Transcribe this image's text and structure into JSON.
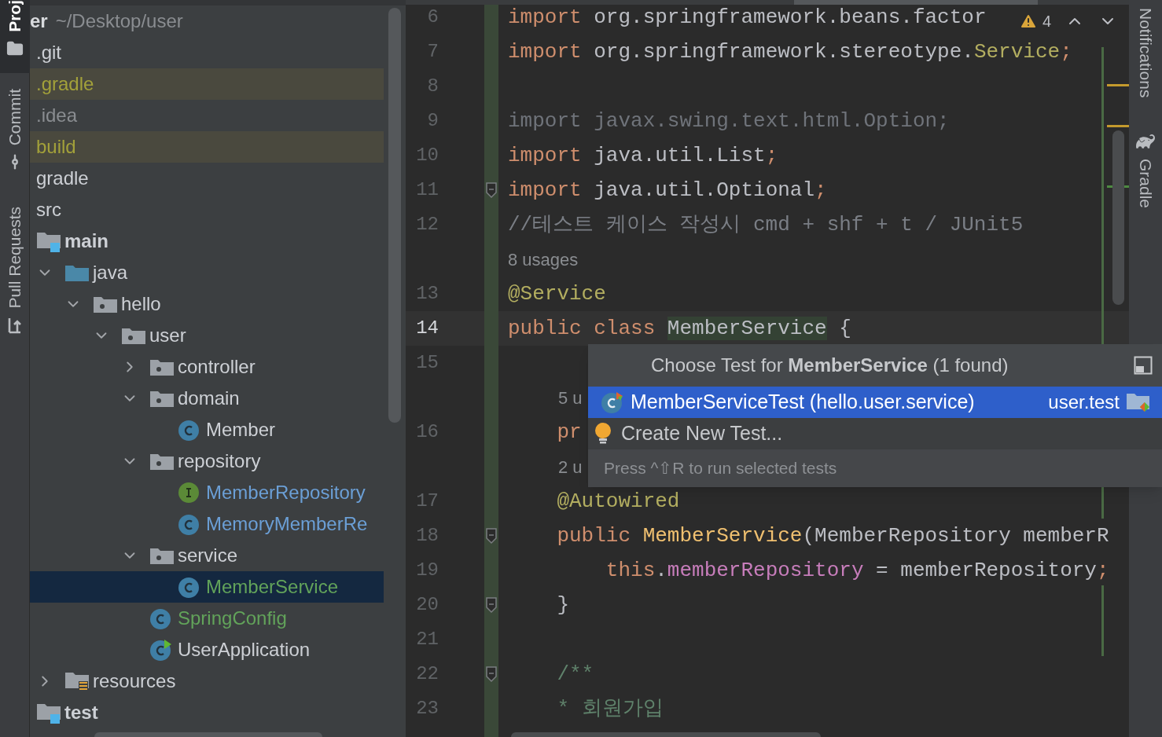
{
  "tool_windows_left": [
    {
      "label": "Proj",
      "kind": "project",
      "selected": true
    },
    {
      "label": "Commit",
      "kind": "commit",
      "selected": false
    },
    {
      "label": "Pull Requests",
      "kind": "pull-requests",
      "selected": false
    }
  ],
  "tool_windows_right": [
    {
      "label": "Notifications",
      "kind": "notifications"
    },
    {
      "label": "Gradle",
      "kind": "gradle"
    }
  ],
  "project_tree": {
    "root": {
      "label": "er",
      "path": "~/Desktop/user"
    },
    "items": [
      {
        "label": ".git",
        "color": "#cdd0d5",
        "excluded": false,
        "selected": false
      },
      {
        "label": ".gradle",
        "color": "#a3a13a",
        "excluded": true,
        "selected": false
      },
      {
        "label": ".idea",
        "color": "#8a8d91",
        "excluded": false,
        "selected": false
      },
      {
        "label": "build",
        "color": "#a3a13a",
        "excluded": true,
        "selected": false
      },
      {
        "label": "gradle",
        "color": "#cdd0d5",
        "excluded": false,
        "selected": false
      },
      {
        "label": "src",
        "color": "#cdd0d5",
        "excluded": false,
        "selected": false,
        "children": [
          {
            "label": "main",
            "kind": "source-root",
            "color": "#cdd0d5",
            "excluded": false,
            "selected": false,
            "children": [
              {
                "label": "java",
                "kind": "source-folder",
                "color": "#cdd0d5",
                "excluded": false,
                "selected": false,
                "expanded": true,
                "children": [
                  {
                    "label": "hello",
                    "kind": "package",
                    "color": "#cdd0d5",
                    "excluded": false,
                    "selected": false,
                    "expanded": true,
                    "children": [
                      {
                        "label": "user",
                        "kind": "package",
                        "color": "#cdd0d5",
                        "excluded": false,
                        "selected": false,
                        "expanded": true,
                        "children": [
                          {
                            "label": "controller",
                            "kind": "package",
                            "color": "#cdd0d5",
                            "excluded": false,
                            "selected": false,
                            "expanded": false
                          },
                          {
                            "label": "domain",
                            "kind": "package",
                            "color": "#cdd0d5",
                            "excluded": false,
                            "selected": false,
                            "expanded": true,
                            "children": [
                              {
                                "label": "Member",
                                "kind": "class",
                                "color": "#cdd0d5",
                                "excluded": false,
                                "selected": false
                              }
                            ]
                          },
                          {
                            "label": "repository",
                            "kind": "package",
                            "color": "#cdd0d5",
                            "excluded": false,
                            "selected": false,
                            "expanded": true,
                            "children": [
                              {
                                "label": "MemberRepository",
                                "kind": "interface",
                                "color": "#6b9fd6",
                                "excluded": false,
                                "selected": false
                              },
                              {
                                "label": "MemoryMemberRe",
                                "kind": "class",
                                "color": "#6b9fd6",
                                "excluded": false,
                                "selected": false
                              }
                            ]
                          },
                          {
                            "label": "service",
                            "kind": "package",
                            "color": "#cdd0d5",
                            "excluded": false,
                            "selected": false,
                            "expanded": true,
                            "children": [
                              {
                                "label": "MemberService",
                                "kind": "class",
                                "color": "#62a35a",
                                "excluded": false,
                                "selected": true
                              }
                            ]
                          },
                          {
                            "label": "SpringConfig",
                            "kind": "class",
                            "color": "#62a35a",
                            "excluded": false,
                            "selected": false
                          },
                          {
                            "label": "UserApplication",
                            "kind": "app-class",
                            "color": "#cdd0d5",
                            "excluded": false,
                            "selected": false
                          }
                        ]
                      }
                    ]
                  }
                ]
              },
              {
                "label": "resources",
                "kind": "resources",
                "color": "#cdd0d5",
                "excluded": false,
                "selected": false,
                "expanded": false
              }
            ]
          },
          {
            "label": "test",
            "kind": "source-root",
            "color": "#cdd0d5",
            "excluded": false,
            "selected": false
          }
        ]
      }
    ]
  },
  "editor": {
    "problems": {
      "count": "4"
    },
    "lines": [
      {
        "kind": "code",
        "number": "6",
        "current": false,
        "fold": false,
        "tokens": [
          {
            "t": "import",
            "kind": "keyword"
          },
          {
            "t": " org.springframework.beans.factor",
            "kind": "plain"
          }
        ]
      },
      {
        "kind": "code",
        "number": "7",
        "current": false,
        "fold": false,
        "tokens": [
          {
            "t": "import",
            "kind": "keyword"
          },
          {
            "t": " org.springframework.stereotype.",
            "kind": "plain"
          },
          {
            "t": "Service",
            "kind": "annotation"
          },
          {
            "t": ";",
            "kind": "keyword"
          }
        ]
      },
      {
        "kind": "code",
        "number": "8",
        "current": false,
        "fold": false
      },
      {
        "kind": "code",
        "number": "9",
        "current": false,
        "fold": false,
        "tokens": [
          {
            "t": "import javax.swing.text.html.Option;",
            "kind": "unused"
          }
        ]
      },
      {
        "kind": "code",
        "number": "10",
        "current": false,
        "fold": false,
        "tokens": [
          {
            "t": "import",
            "kind": "keyword"
          },
          {
            "t": " java.util.List",
            "kind": "plain"
          },
          {
            "t": ";",
            "kind": "keyword"
          }
        ]
      },
      {
        "kind": "code",
        "number": "11",
        "current": false,
        "fold": true,
        "tokens": [
          {
            "t": "import",
            "kind": "keyword"
          },
          {
            "t": " java.util.Optional",
            "kind": "plain"
          },
          {
            "t": ";",
            "kind": "keyword"
          }
        ]
      },
      {
        "kind": "code",
        "number": "12",
        "current": false,
        "fold": false,
        "tokens": [
          {
            "t": "//테스트 케이스 작성시 cmd + shf + t / JUnit5",
            "kind": "comment"
          }
        ]
      },
      {
        "kind": "inlay",
        "text": "8 usages",
        "nested": false
      },
      {
        "kind": "code",
        "number": "13",
        "current": false,
        "fold": false,
        "tokens": [
          {
            "t": "@Service",
            "kind": "annotation"
          }
        ]
      },
      {
        "kind": "code",
        "number": "14",
        "current": true,
        "fold": false,
        "tokens": [
          {
            "t": "public class ",
            "kind": "keyword"
          },
          {
            "t": "MemberService",
            "kind": "highlight"
          },
          {
            "t": " {",
            "kind": "plain"
          }
        ]
      },
      {
        "kind": "code",
        "number": "15",
        "current": false,
        "fold": false
      },
      {
        "kind": "inlay",
        "text": "5 u",
        "nested": true
      },
      {
        "kind": "code",
        "number": "16",
        "current": false,
        "fold": false,
        "tokens": [
          {
            "t": "    pr",
            "kind": "keyword"
          }
        ]
      },
      {
        "kind": "inlay",
        "text": "2 u",
        "nested": true
      },
      {
        "kind": "code",
        "number": "17",
        "current": false,
        "fold": false,
        "tokens": [
          {
            "t": "    @Autowired",
            "kind": "annotation"
          }
        ]
      },
      {
        "kind": "code",
        "number": "18",
        "current": false,
        "fold": true,
        "tokens": [
          {
            "t": "    public ",
            "kind": "keyword"
          },
          {
            "t": "MemberService",
            "kind": "method"
          },
          {
            "t": "(MemberRepository memberR",
            "kind": "plain"
          }
        ]
      },
      {
        "kind": "code",
        "number": "19",
        "current": false,
        "fold": false,
        "tokens": [
          {
            "t": "        this",
            "kind": "keyword"
          },
          {
            "t": ".",
            "kind": "plain"
          },
          {
            "t": "memberRepository",
            "kind": "field"
          },
          {
            "t": " = memberRepository",
            "kind": "plain"
          },
          {
            "t": ";",
            "kind": "keyword"
          }
        ]
      },
      {
        "kind": "code",
        "number": "20",
        "current": false,
        "fold": true,
        "tokens": [
          {
            "t": "    }",
            "kind": "plain"
          }
        ]
      },
      {
        "kind": "code",
        "number": "21",
        "current": false,
        "fold": false
      },
      {
        "kind": "code",
        "number": "22",
        "current": false,
        "fold": true,
        "tokens": [
          {
            "t": "    /**",
            "kind": "doc"
          }
        ]
      },
      {
        "kind": "code",
        "number": "23",
        "current": false,
        "fold": false,
        "tokens": [
          {
            "t": "    * 회원가입",
            "kind": "doc"
          }
        ]
      }
    ]
  },
  "test_popup": {
    "title": "Choose Test for **MemberService** (1 found)",
    "items": [
      {
        "kind": "test",
        "label": "MemberServiceTest (hello.user.service)",
        "module": "user.test",
        "selected": true
      },
      {
        "kind": "create",
        "label": "Create New Test...",
        "selected": false
      }
    ],
    "hint": "Press ^⇧R to run selected tests"
  }
}
